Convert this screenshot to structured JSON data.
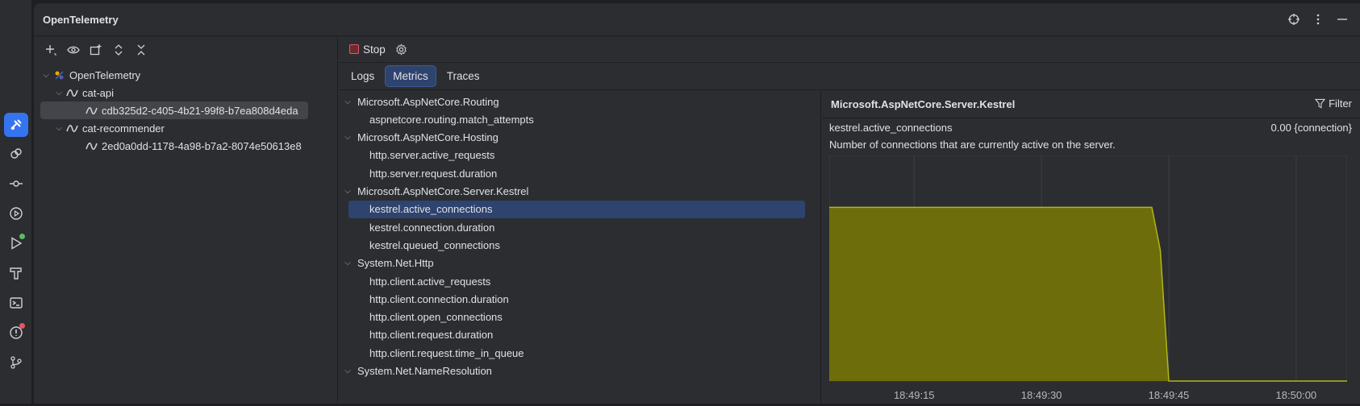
{
  "panel": {
    "title": "OpenTelemetry"
  },
  "left_tools": [
    "add-icon",
    "eye-icon",
    "new-tab-icon",
    "expand-all-icon",
    "collapse-all-icon"
  ],
  "tree": [
    {
      "label": "OpenTelemetry",
      "level": 0,
      "expanded": true,
      "icon": "otel-icon"
    },
    {
      "label": "cat-api",
      "level": 1,
      "expanded": true,
      "icon": "service-icon"
    },
    {
      "label": "cdb325d2-c405-4b21-99f8-b7ea808d4eda",
      "level": 2,
      "icon": "service-icon",
      "selected": true
    },
    {
      "label": "cat-recommender",
      "level": 1,
      "expanded": true,
      "icon": "service-icon"
    },
    {
      "label": "2ed0a0dd-1178-4a98-b7a2-8074e50613e8",
      "level": 2,
      "icon": "service-icon"
    }
  ],
  "toolbar": {
    "stop_label": "Stop"
  },
  "tabs": [
    {
      "label": "Logs",
      "active": false
    },
    {
      "label": "Metrics",
      "active": true
    },
    {
      "label": "Traces",
      "active": false
    }
  ],
  "metrics": [
    {
      "label": "Microsoft.AspNetCore.Routing",
      "group": true
    },
    {
      "label": "aspnetcore.routing.match_attempts"
    },
    {
      "label": "Microsoft.AspNetCore.Hosting",
      "group": true
    },
    {
      "label": "http.server.active_requests"
    },
    {
      "label": "http.server.request.duration"
    },
    {
      "label": "Microsoft.AspNetCore.Server.Kestrel",
      "group": true
    },
    {
      "label": "kestrel.active_connections",
      "selected": true
    },
    {
      "label": "kestrel.connection.duration"
    },
    {
      "label": "kestrel.queued_connections"
    },
    {
      "label": "System.Net.Http",
      "group": true
    },
    {
      "label": "http.client.active_requests"
    },
    {
      "label": "http.client.connection.duration"
    },
    {
      "label": "http.client.open_connections"
    },
    {
      "label": "http.client.request.duration"
    },
    {
      "label": "http.client.request.time_in_queue"
    },
    {
      "label": "System.Net.NameResolution",
      "group": true
    }
  ],
  "detail": {
    "header": "Microsoft.AspNetCore.Server.Kestrel",
    "filter_label": "Filter",
    "metric_name": "kestrel.active_connections",
    "metric_value": "0.00 {connection}",
    "description": "Number of connections that are currently active on the server."
  },
  "chart_data": {
    "type": "area",
    "x_ticks": [
      "18:49:15",
      "18:49:30",
      "18:49:45",
      "18:50:00"
    ],
    "x": [
      "18:49:05",
      "18:49:43",
      "18:49:44",
      "18:49:45",
      "18:50:06"
    ],
    "values": [
      0.77,
      0.77,
      0.58,
      0,
      0
    ],
    "ylim": [
      0,
      1
    ],
    "grid": true,
    "colors": {
      "fill": "#6e6d0c",
      "line": "#b5b514",
      "grid": "#3c3e42",
      "plot_bg": "#2b2d30",
      "axis_text": "#b4b8bf"
    }
  }
}
